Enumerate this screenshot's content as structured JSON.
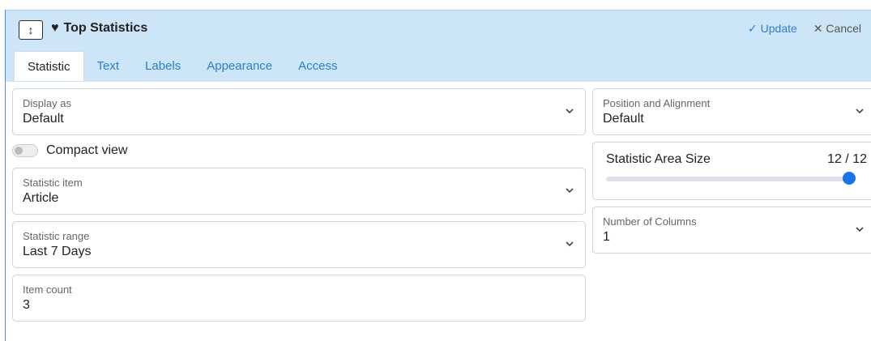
{
  "header": {
    "sort_glyph": "↕",
    "title": "Top Statistics",
    "update_label": "✓ Update",
    "cancel_label": "✕ Cancel"
  },
  "tabs": [
    "Statistic",
    "Text",
    "Labels",
    "Appearance",
    "Access"
  ],
  "left": {
    "display_as": {
      "label": "Display as",
      "value": "Default"
    },
    "compact_view": {
      "label": "Compact view",
      "enabled": false
    },
    "statistic_item": {
      "label": "Statistic item",
      "value": "Article"
    },
    "statistic_range": {
      "label": "Statistic range",
      "value": "Last 7 Days"
    },
    "item_count": {
      "label": "Item count",
      "value": "3"
    }
  },
  "right": {
    "position_alignment": {
      "label": "Position and Alignment",
      "value": "Default"
    },
    "area_size": {
      "label": "Statistic Area Size",
      "value": "12 / 12",
      "fraction": 1.0
    },
    "columns": {
      "label": "Number of Columns",
      "value": "1"
    }
  },
  "colors": {
    "accent": "#2b7fd1",
    "header_bg": "#cce5f7",
    "slider": "#1a73e8"
  }
}
